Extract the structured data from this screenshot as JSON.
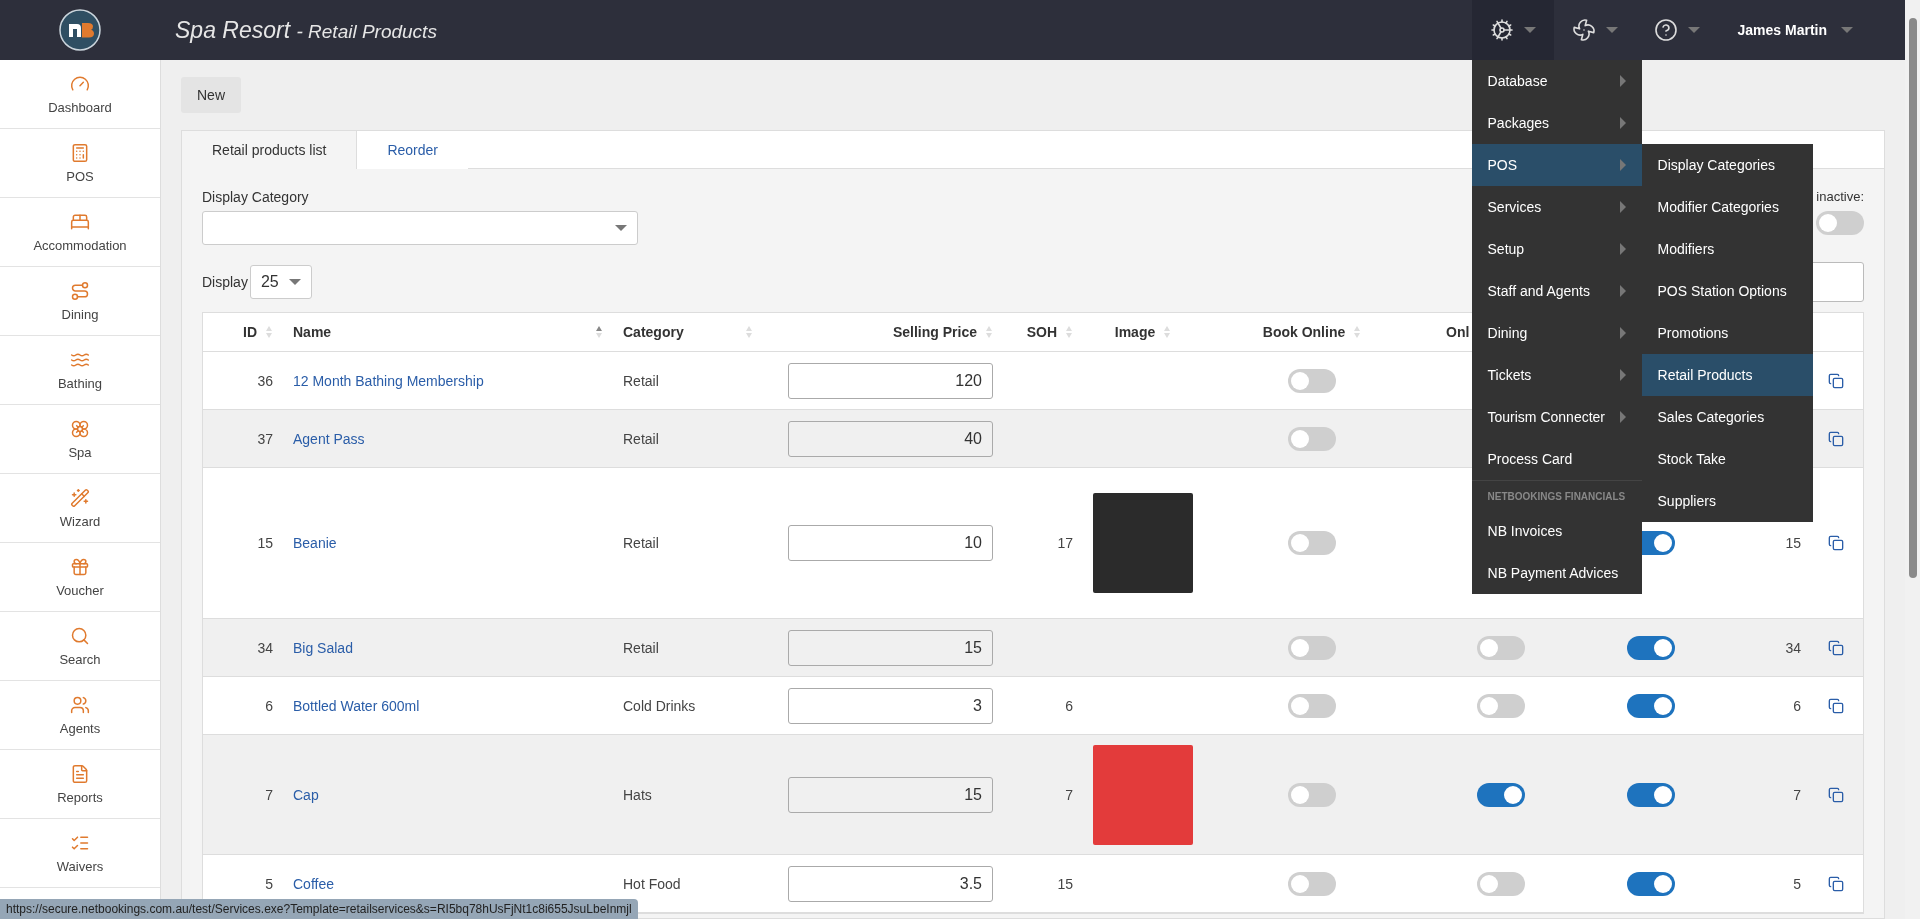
{
  "header": {
    "title": "Spa Resort",
    "subtitle": "- Retail Products",
    "user": "James Martin",
    "tools": [
      {
        "kind": "settings",
        "open": true
      },
      {
        "kind": "fan",
        "open": false
      },
      {
        "kind": "help",
        "open": false
      }
    ]
  },
  "sidebar": {
    "items": [
      {
        "label": "Dashboard"
      },
      {
        "label": "POS"
      },
      {
        "label": "Accommodation"
      },
      {
        "label": "Dining"
      },
      {
        "label": "Bathing"
      },
      {
        "label": "Spa"
      },
      {
        "label": "Wizard"
      },
      {
        "label": "Voucher"
      },
      {
        "label": "Search"
      },
      {
        "label": "Agents"
      },
      {
        "label": "Reports"
      },
      {
        "label": "Waivers"
      }
    ]
  },
  "new_button": "New",
  "tabs": [
    {
      "label": "Retail products list",
      "selected": true
    },
    {
      "label": "Reorder",
      "selected": false
    }
  ],
  "filters": {
    "display_category_label": "Display Category",
    "display_label": "Display",
    "page_size": "25",
    "inactive_label": "inactive:",
    "show_inactive": false
  },
  "table": {
    "columns": [
      {
        "label": "ID",
        "sorted": false
      },
      {
        "label": "Name",
        "sorted": true
      },
      {
        "label": "Category",
        "sorted": false
      },
      {
        "label": "Selling Price",
        "sorted": false
      },
      {
        "label": "SOH",
        "sorted": false
      },
      {
        "label": "Image",
        "sorted": false
      },
      {
        "label": "Book Online",
        "sorted": false
      },
      {
        "label": "Onl"
      }
    ],
    "rows": [
      {
        "id": "36",
        "name": "12 Month Bathing Membership",
        "category": "Retail",
        "price": "120",
        "soh": "",
        "image": false,
        "book_online": false,
        "column_8": null,
        "column_9": null,
        "column_10": ""
      },
      {
        "id": "37",
        "name": "Agent Pass",
        "category": "Retail",
        "price": "40",
        "soh": "",
        "image": false,
        "book_online": false,
        "column_8": null,
        "column_9": null,
        "column_10": ""
      },
      {
        "id": "15",
        "name": "Beanie",
        "category": "Retail",
        "price": "10",
        "soh": "17",
        "image": true,
        "book_online": false,
        "column_8": null,
        "column_9": true,
        "column_10": "15"
      },
      {
        "id": "34",
        "name": "Big Salad",
        "category": "Retail",
        "price": "15",
        "soh": "",
        "image": false,
        "book_online": false,
        "column_8": false,
        "column_9": true,
        "column_10": "34"
      },
      {
        "id": "6",
        "name": "Bottled Water 600ml",
        "category": "Cold Drinks",
        "price": "3",
        "soh": "6",
        "image": false,
        "book_online": false,
        "column_8": false,
        "column_9": true,
        "column_10": "6"
      },
      {
        "id": "7",
        "name": "Cap",
        "category": "Hats",
        "price": "15",
        "soh": "7",
        "image": true,
        "book_online": false,
        "column_8": true,
        "column_9": true,
        "column_10": "7"
      },
      {
        "id": "5",
        "name": "Coffee",
        "category": "Hot Food",
        "price": "3.5",
        "soh": "15",
        "image": false,
        "book_online": false,
        "column_8": false,
        "column_9": true,
        "column_10": "5"
      }
    ]
  },
  "menu": {
    "items": [
      {
        "kind": "item",
        "label": "Database",
        "submenu": true,
        "selected": false
      },
      {
        "kind": "item",
        "label": "Packages",
        "submenu": true,
        "selected": false
      },
      {
        "kind": "item",
        "label": "POS",
        "submenu": true,
        "selected": true
      },
      {
        "kind": "item",
        "label": "Services",
        "submenu": true,
        "selected": false
      },
      {
        "kind": "item",
        "label": "Setup",
        "submenu": true,
        "selected": false
      },
      {
        "kind": "item",
        "label": "Staff and Agents",
        "submenu": true,
        "selected": false
      },
      {
        "kind": "item",
        "label": "Dining",
        "submenu": true,
        "selected": false
      },
      {
        "kind": "item",
        "label": "Tickets",
        "submenu": true,
        "selected": false
      },
      {
        "kind": "item",
        "label": "Tourism Connecter",
        "submenu": true,
        "selected": false
      },
      {
        "kind": "item",
        "label": "Process Card",
        "submenu": false,
        "selected": false
      },
      {
        "kind": "section",
        "label": "NETBOOKINGS FINANCIALS"
      },
      {
        "kind": "item",
        "label": "NB Invoices",
        "submenu": false,
        "selected": false
      },
      {
        "kind": "item",
        "label": "NB Payment Advices",
        "submenu": false,
        "selected": false
      }
    ],
    "submenu": [
      {
        "label": "Display Categories",
        "selected": false
      },
      {
        "label": "Modifier Categories",
        "selected": false
      },
      {
        "label": "Modifiers",
        "selected": false
      },
      {
        "label": "POS Station Options",
        "selected": false
      },
      {
        "label": "Promotions",
        "selected": false
      },
      {
        "label": "Retail Products",
        "selected": true
      },
      {
        "label": "Sales Categories",
        "selected": false
      },
      {
        "label": "Stock Take",
        "selected": false
      },
      {
        "label": "Suppliers",
        "selected": false
      }
    ]
  },
  "status_url": "https://secure.netbookings.com.au/test/Services.exe?Template=retailservices&s=RI5bq78hUsFjNt1c8i655JsuLbeInmjl"
}
